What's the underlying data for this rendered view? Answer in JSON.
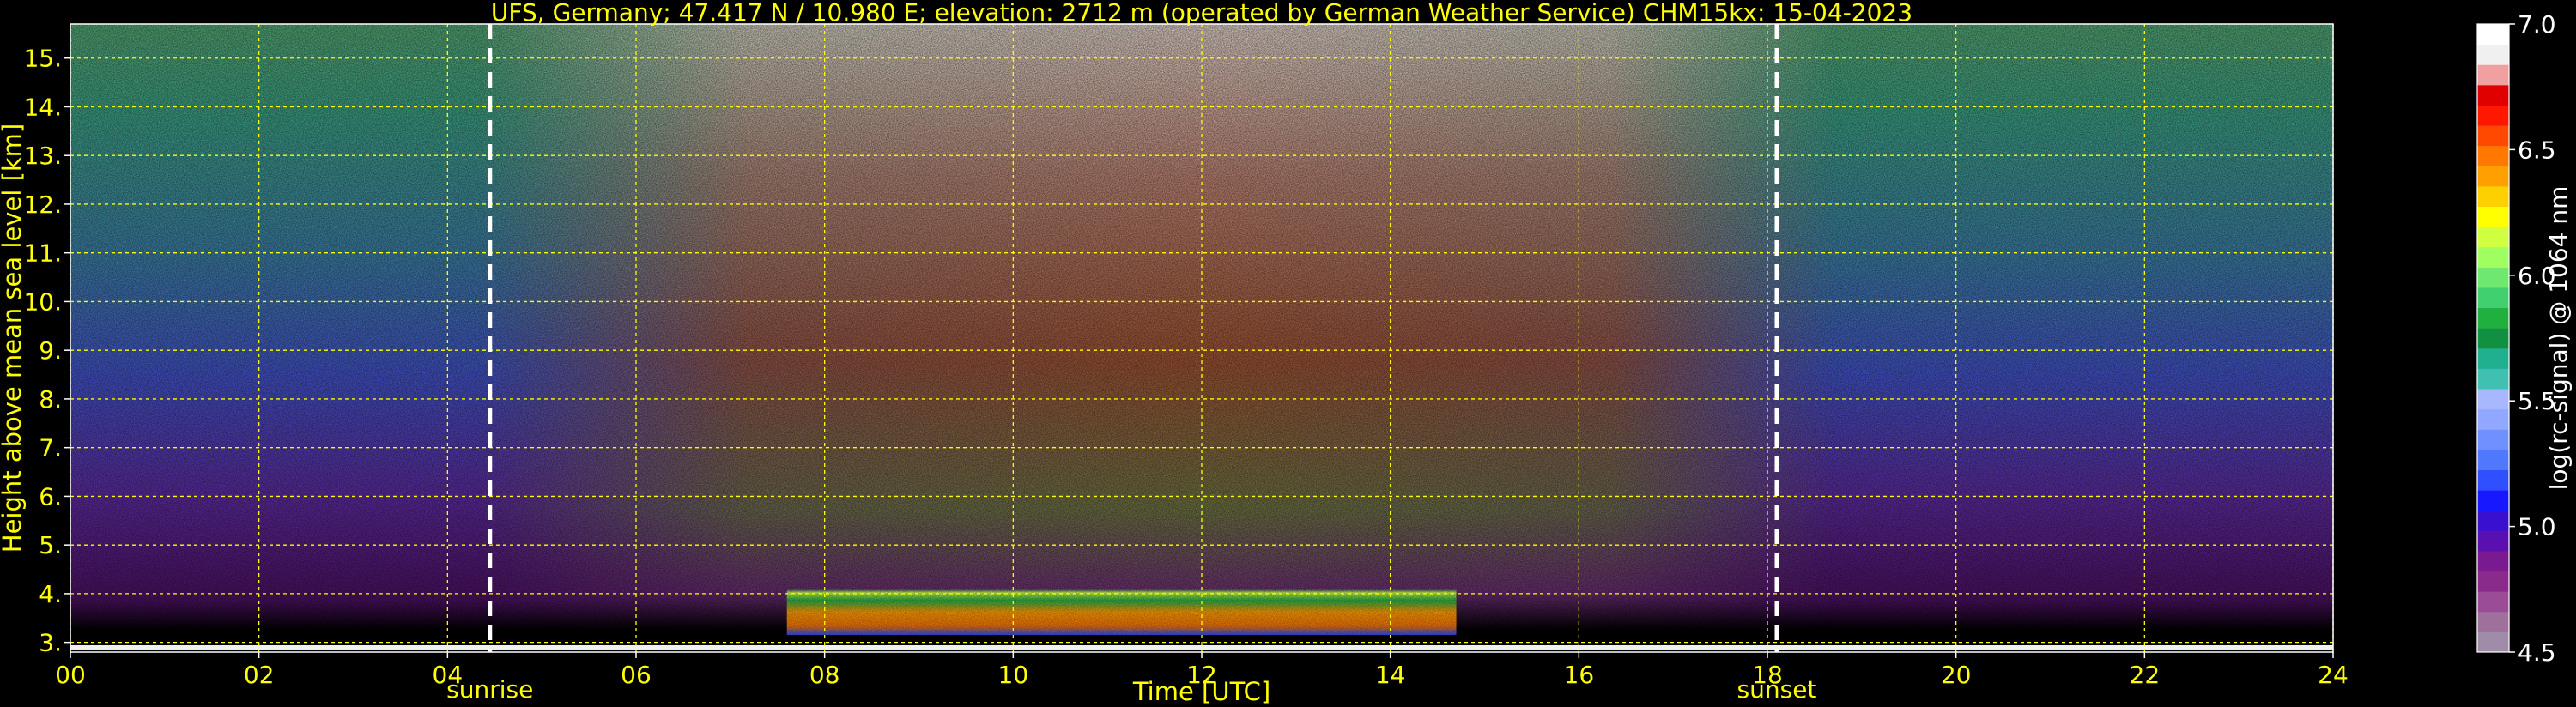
{
  "chart_data": {
    "type": "heatmap",
    "title": "UFS, Germany; 47.417 N / 10.980 E; elevation: 2712 m  (operated by German Weather Service)    CHM15kx: 15-04-2023",
    "xlabel": "Time [UTC]",
    "ylabel": "Height above mean sea level [km]",
    "xlim": [
      0,
      24
    ],
    "ylim": [
      2.8,
      15.7
    ],
    "x_ticks": [
      "00",
      "02",
      "04",
      "06",
      "08",
      "10",
      "12",
      "14",
      "16",
      "18",
      "20",
      "22",
      "24"
    ],
    "x_tick_values": [
      0,
      2,
      4,
      6,
      8,
      10,
      12,
      14,
      16,
      18,
      20,
      22,
      24
    ],
    "y_ticks": [
      "3.",
      "4.",
      "5.",
      "6.",
      "7.",
      "8.",
      "9.",
      "10.",
      "11.",
      "12.",
      "13.",
      "14.",
      "15."
    ],
    "y_tick_values": [
      3,
      4,
      5,
      6,
      7,
      8,
      9,
      10,
      11,
      12,
      13,
      14,
      15
    ],
    "grid": true,
    "grid_color": "#ffff00",
    "annotations": [
      {
        "label": "sunrise",
        "x": 4.45
      },
      {
        "label": "sunset",
        "x": 18.1
      }
    ],
    "cloud_layer": {
      "x_start": 7.6,
      "x_end": 14.7,
      "y_bottom": 3.15,
      "y_top": 4.1
    },
    "colorbar": {
      "label": "log(rc-signal) @ 1064 nm",
      "range": [
        4.5,
        7.0
      ],
      "ticks": [
        "4.5",
        "5.0",
        "5.5",
        "6.0",
        "6.5",
        "7.0"
      ],
      "tick_values": [
        4.5,
        5.0,
        5.5,
        6.0,
        6.5,
        7.0
      ],
      "colors": [
        "#a08ca8",
        "#a0709c",
        "#9a4c96",
        "#8a2a8a",
        "#7a1a90",
        "#5a10b0",
        "#3a10d0",
        "#1818ff",
        "#3050ff",
        "#5078ff",
        "#7090ff",
        "#90a8ff",
        "#a8b8ff",
        "#40c0b0",
        "#20b090",
        "#109040",
        "#20b040",
        "#40d070",
        "#70e870",
        "#a0ff60",
        "#d0ff40",
        "#ffff00",
        "#ffd000",
        "#ffa000",
        "#ff7800",
        "#ff4800",
        "#ff1800",
        "#e00000",
        "#f0a0a0",
        "#f0f0f0",
        "#ffffff"
      ]
    }
  }
}
